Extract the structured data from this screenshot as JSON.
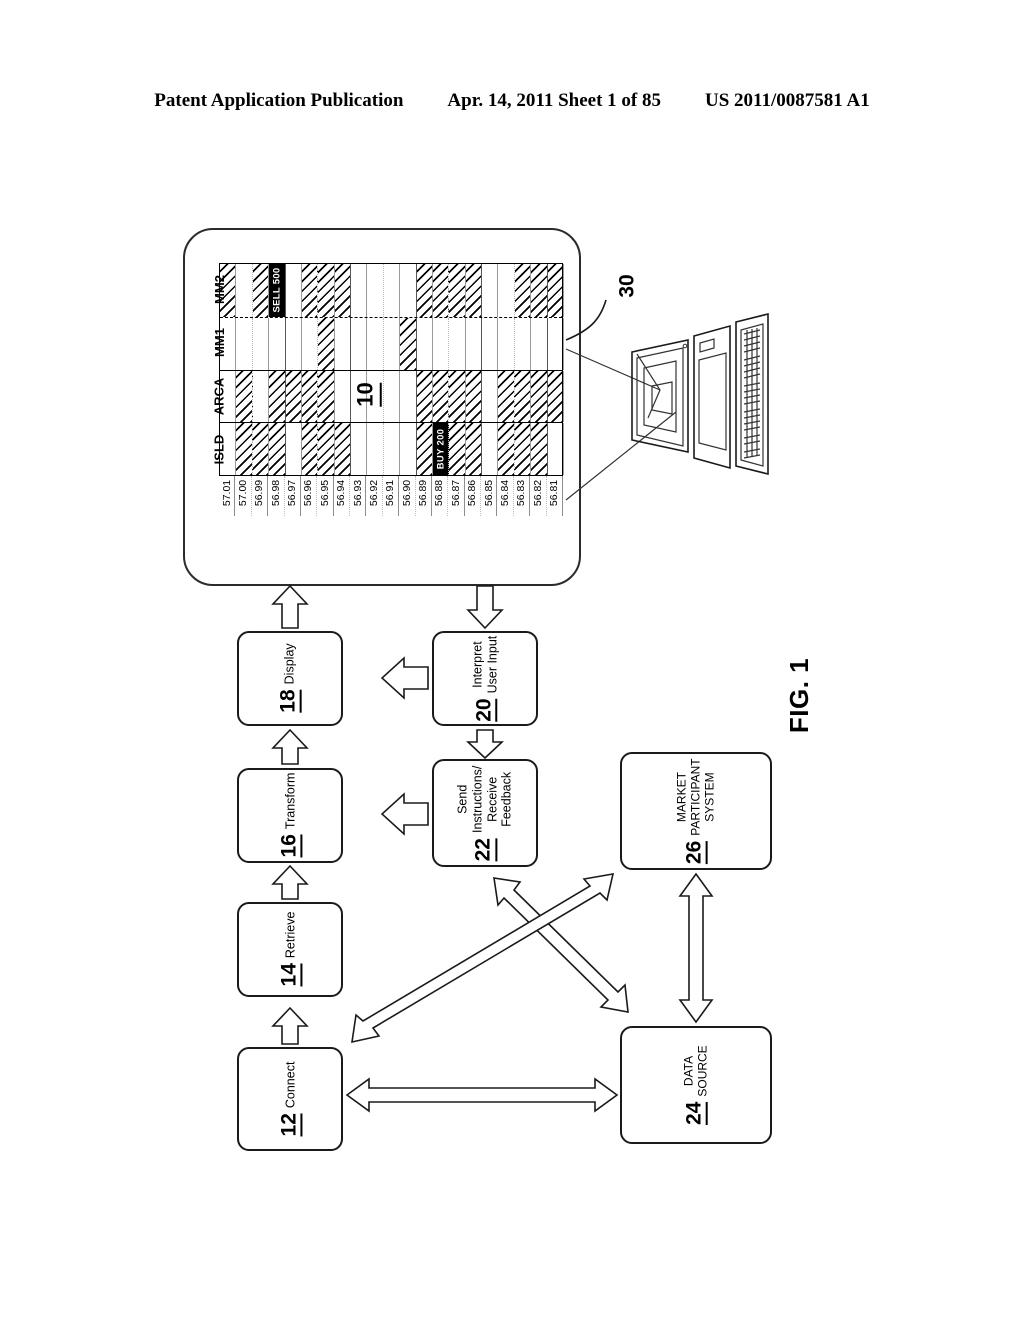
{
  "header": {
    "publication": "Patent Application Publication",
    "date_sheet": "Apr. 14, 2011  Sheet 1 of 85",
    "patent_number": "US 2011/0087581 A1"
  },
  "figure": {
    "label": "FIG. 1",
    "screen_ref": "10",
    "computer_ref": "30"
  },
  "trading_grid": {
    "venues": [
      "MM2",
      "MM1",
      "ARCA",
      "ISLD"
    ],
    "prices": [
      "57.01",
      "57.00",
      "56.99",
      "56.98",
      "56.97",
      "56.96",
      "56.95",
      "56.94",
      "56.93",
      "56.92",
      "56.91",
      "56.90",
      "56.89",
      "56.88",
      "56.87",
      "56.86",
      "56.85",
      "56.84",
      "56.83",
      "56.82",
      "56.81"
    ],
    "orders": [
      {
        "label": "SELL 500",
        "venue": "MM2",
        "price": "56.98"
      },
      {
        "label": "BUY 200",
        "venue": "ISLD",
        "price": "56.88"
      }
    ],
    "liquidity": {
      "MM2": [
        1,
        0,
        1,
        1,
        0,
        1,
        1,
        1,
        0,
        0,
        0,
        0,
        1,
        1,
        1,
        1,
        0,
        0,
        1,
        1,
        1
      ],
      "MM1": [
        0,
        0,
        0,
        0,
        0,
        0,
        1,
        0,
        0,
        0,
        0,
        1,
        0,
        0,
        0,
        0,
        0,
        0,
        0,
        0,
        0
      ],
      "ARCA": [
        0,
        1,
        0,
        1,
        1,
        1,
        1,
        0,
        0,
        0,
        0,
        0,
        1,
        1,
        1,
        1,
        0,
        1,
        1,
        1,
        1
      ],
      "ISLD": [
        0,
        1,
        1,
        1,
        0,
        1,
        1,
        1,
        0,
        0,
        0,
        0,
        1,
        1,
        1,
        1,
        0,
        1,
        1,
        1,
        0
      ]
    }
  },
  "flow": {
    "boxes": [
      {
        "num": "12",
        "label": "Connect"
      },
      {
        "num": "14",
        "label": "Retrieve"
      },
      {
        "num": "16",
        "label": "Transform"
      },
      {
        "num": "18",
        "label": "Display"
      },
      {
        "num": "20",
        "label": "Interpret\nUser Input"
      },
      {
        "num": "22",
        "label": "Send\nInstructions/\nReceive\nFeedback"
      },
      {
        "num": "24",
        "label": "DATA\nSOURCE"
      },
      {
        "num": "26",
        "label": "MARKET\nPARTICIPANT\nSYSTEM"
      }
    ]
  },
  "colors": {
    "ink": "#000000",
    "grid_line": "#8e8e8e",
    "order_fill": "#000000",
    "order_text": "#ffffff"
  }
}
